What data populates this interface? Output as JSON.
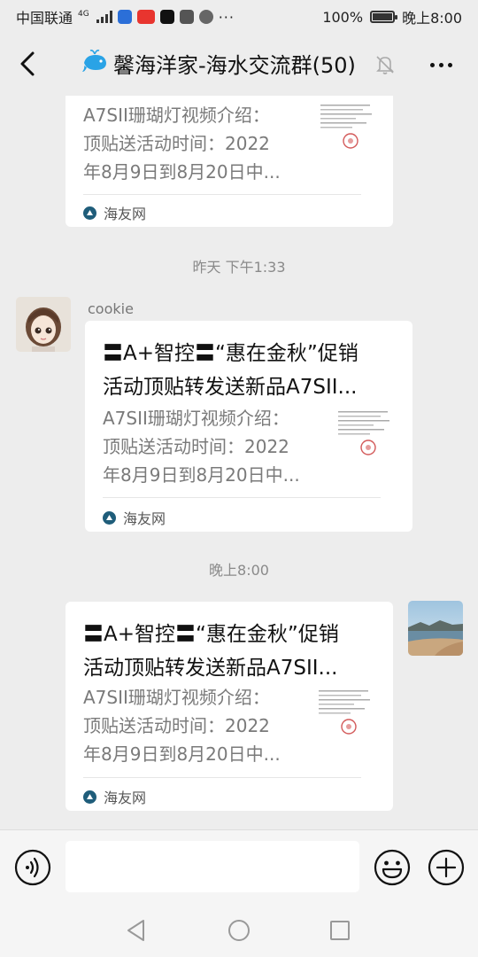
{
  "status_bar": {
    "carrier": "中国联通",
    "network": "4G",
    "battery": "100%",
    "time": "晚上8:00"
  },
  "header": {
    "title": "馨海洋家-海水交流群(50)",
    "title_icon": "whale-icon",
    "back_icon": "chevron-left-icon",
    "mute_icon": "bell-muted-icon",
    "more_icon": "more-dots-icon"
  },
  "messages": [
    {
      "type": "link_card",
      "title": "",
      "desc": "A7SII珊瑚灯视频介绍：顶贴送活动时间：2022年8月9日到8月20日中...",
      "desc_lines": [
        "A7SII珊瑚灯视频介绍：",
        "顶贴送活动时间：2022",
        "年8月9日到8月20日中..."
      ],
      "source": "海友网"
    },
    {
      "type": "time",
      "text": "昨天 下午1:33"
    },
    {
      "type": "link_card",
      "sender": "cookie",
      "title_lines": [
        "〓A+智控〓“惠在金秋”促销",
        "活动顶贴转发送新品A7SII..."
      ],
      "desc_lines": [
        "A7SII珊瑚灯视频介绍：",
        "顶贴送活动时间：2022",
        "年8月9日到8月20日中..."
      ],
      "source": "海友网"
    },
    {
      "type": "time",
      "text": "晚上8:00"
    },
    {
      "type": "link_card",
      "title_lines": [
        "〓A+智控〓“惠在金秋”促销",
        "活动顶贴转发送新品A7SII..."
      ],
      "desc_lines": [
        "A7SII珊瑚灯视频介绍：",
        "顶贴送活动时间：2022",
        "年8月9日到8月20日中..."
      ],
      "source": "海友网"
    }
  ],
  "input_bar": {
    "voice_icon": "voice-icon",
    "text_value": "",
    "emoji_icon": "emoji-icon",
    "plus_icon": "plus-icon"
  },
  "nav_bar": {
    "back_icon": "nav-back-icon",
    "home_icon": "nav-home-icon",
    "recents_icon": "nav-recents-icon"
  },
  "colors": {
    "background": "#ededed",
    "card": "#ffffff",
    "secondary_text": "#7a7a7a"
  }
}
